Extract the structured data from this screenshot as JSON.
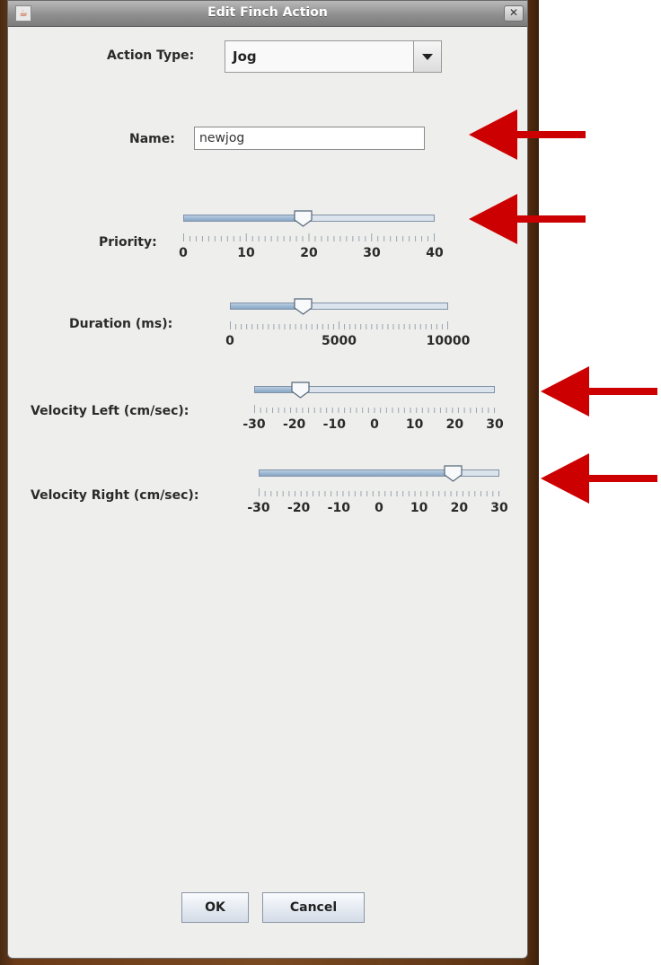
{
  "window": {
    "title": "Edit Finch Action"
  },
  "action_type": {
    "label": "Action Type:",
    "value": "Jog"
  },
  "name": {
    "label": "Name:",
    "value": "newjog"
  },
  "priority": {
    "label": "Priority:",
    "min": 0,
    "max": 40,
    "value": 19,
    "ticks": [
      "0",
      "10",
      "20",
      "30",
      "40"
    ]
  },
  "duration": {
    "label": "Duration (ms):",
    "min": 0,
    "max": 10000,
    "value": 3200,
    "ticks": [
      "0",
      "5000",
      "10000"
    ]
  },
  "velocity_left": {
    "label": "Velocity Left (cm/sec):",
    "min": -30,
    "max": 30,
    "value": -20,
    "ticks": [
      "-30",
      "-20",
      "-10",
      "0",
      "10",
      "20",
      "30"
    ]
  },
  "velocity_right": {
    "label": "Velocity Right (cm/sec):",
    "min": -30,
    "max": 30,
    "value": 20,
    "ticks": [
      "-30",
      "-20",
      "-10",
      "0",
      "10",
      "20",
      "30"
    ]
  },
  "buttons": {
    "ok": "OK",
    "cancel": "Cancel"
  },
  "colors": {
    "annotation_arrow": "#cc0000",
    "slider_fill": "#88a6c5"
  }
}
